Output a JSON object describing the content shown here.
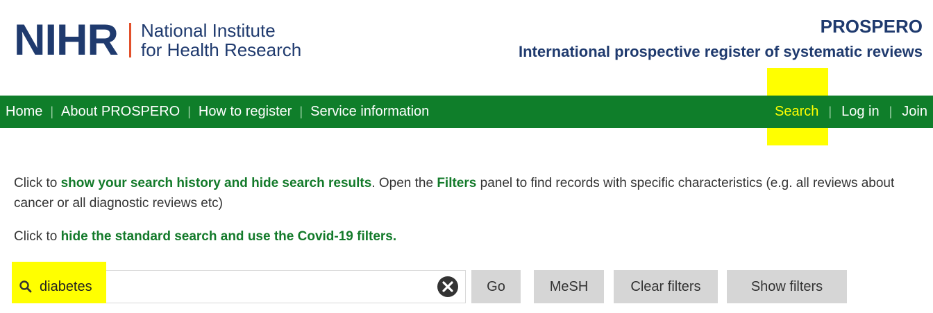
{
  "logo": {
    "acronym": "NIHR",
    "line1": "National Institute",
    "line2": "for Health Research"
  },
  "brand": {
    "title": "PROSPERO",
    "subtitle": "International prospective register of systematic reviews"
  },
  "nav": {
    "left": [
      "Home",
      "About PROSPERO",
      "How to register",
      "Service information"
    ],
    "right": [
      "Search",
      "Log in",
      "Join"
    ],
    "separator": "|"
  },
  "content": {
    "p1_prefix": "Click to ",
    "p1_link": "show your search history and hide search results",
    "p1_mid": ". Open the ",
    "p1_filters": "Filters",
    "p1_suffix": " panel to find records with specific characteristics (e.g. all reviews about cancer or all diagnostic reviews etc)",
    "p2_prefix": "Click to ",
    "p2_link": "hide the standard search and use the Covid-19 filters."
  },
  "search": {
    "value": "diabetes",
    "icon": "search-icon",
    "clear_icon": "clear-icon"
  },
  "buttons": {
    "go": "Go",
    "mesh": "MeSH",
    "clear_filters": "Clear filters",
    "show_filters": "Show filters"
  },
  "colors": {
    "nav_bg": "#0f7e2a",
    "brand_blue": "#1f3a6e",
    "link_green": "#137a2a",
    "highlight": "#ffff00",
    "button_bg": "#d6d6d6"
  }
}
